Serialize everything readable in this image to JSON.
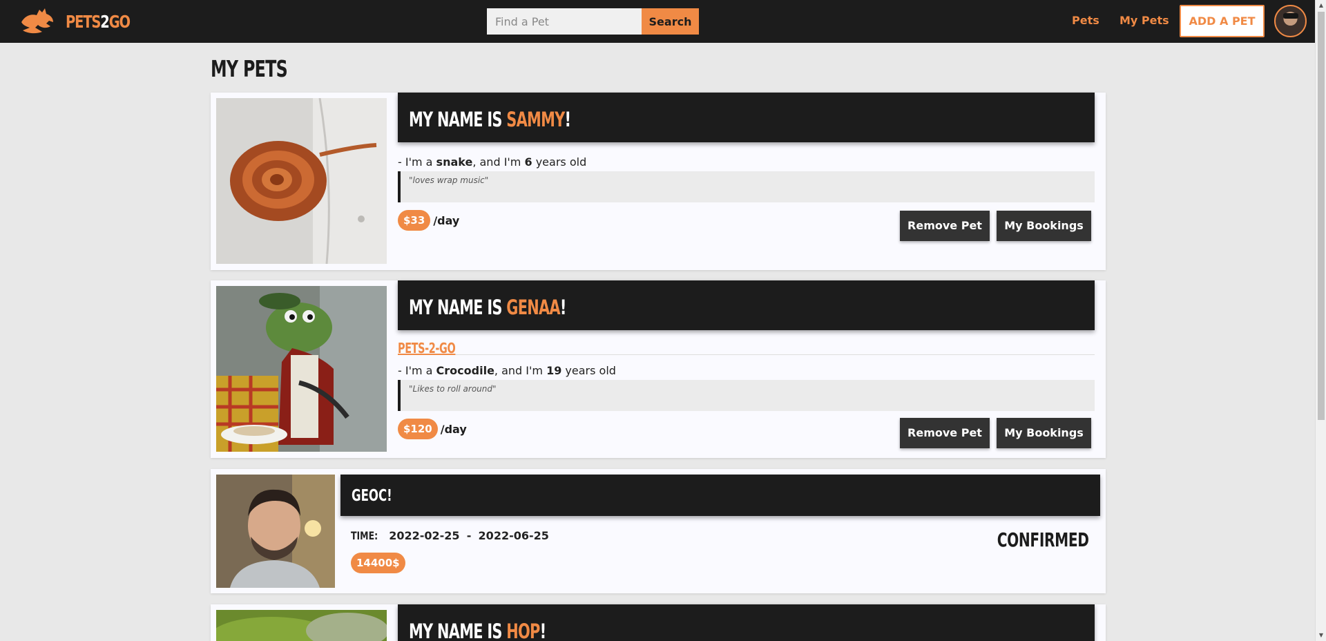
{
  "navbar": {
    "logo_part1": "PETS",
    "logo_part2": "2",
    "logo_part3": "GO",
    "search_placeholder": "Find a Pet",
    "search_button": "Search",
    "link_pets": "Pets",
    "link_my_pets": "My Pets",
    "add_pet_button": "ADD A PET"
  },
  "page": {
    "title": "MY PETS"
  },
  "pets": [
    {
      "name_prefix": "MY NAME IS ",
      "name": "SAMMY",
      "name_suffix": "!",
      "line_prefix": "- I'm a ",
      "species": "snake",
      "line_mid": ", and I'm ",
      "age": "6",
      "line_suffix": " years old",
      "quote": "\"loves wrap music\"",
      "price": "$33",
      "per_day": "/day",
      "remove_label": "Remove Pet",
      "bookings_label": "My Bookings"
    },
    {
      "name_prefix": "MY NAME IS ",
      "name": "GENAA",
      "name_suffix": "!",
      "owner_link": "PETS-2-GO",
      "line_prefix": "- I'm a ",
      "species": "Crocodile",
      "line_mid": ", and I'm ",
      "age": "19",
      "line_suffix": " years old",
      "quote": "\"Likes to roll around\"",
      "price": "$120",
      "per_day": "/day",
      "remove_label": "Remove Pet",
      "bookings_label": "My Bookings"
    },
    {
      "name_prefix": "MY NAME IS ",
      "name": "HOP",
      "name_suffix": "!"
    }
  ],
  "booking": {
    "name": "GEOC!",
    "time_label": "TIME:",
    "start": "2022-02-25",
    "separator": "-",
    "end": "2022-06-25",
    "total": "14400$",
    "status": "CONFIRMED"
  },
  "colors": {
    "accent": "#f08a45",
    "dark": "#1c1c1c",
    "page_bg": "#e8e8e8"
  }
}
